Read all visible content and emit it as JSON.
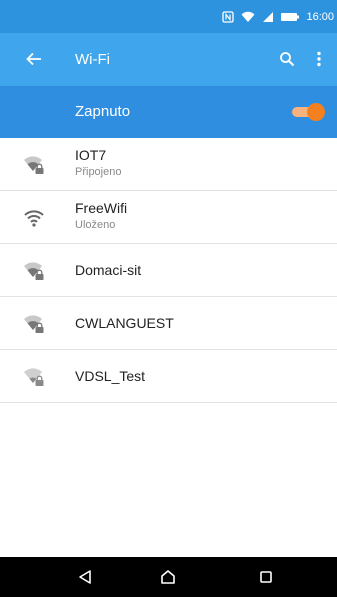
{
  "status": {
    "time": "16:00",
    "icons": [
      "nfc-icon",
      "wifi-signal-icon",
      "cell-signal-icon",
      "battery-icon"
    ]
  },
  "appbar": {
    "title": "Wi-Fi",
    "back_icon": "arrow-left-icon",
    "search_icon": "search-icon",
    "more_icon": "more-vert-icon"
  },
  "master": {
    "label": "Zapnuto",
    "on": true
  },
  "networks": [
    {
      "name": "IOT7",
      "status": "Připojeno",
      "secured": true
    },
    {
      "name": "FreeWifi",
      "status": "Uloženo",
      "secured": false
    },
    {
      "name": "Domaci-sit",
      "status": "",
      "secured": true
    },
    {
      "name": "CWLANGUEST",
      "status": "",
      "secured": true
    },
    {
      "name": "VDSL_Test",
      "status": "",
      "secured": true
    }
  ],
  "nav": {
    "icons": [
      "back-triangle-icon",
      "home-icon",
      "recents-icon"
    ]
  },
  "colors": {
    "status_bar": "#2e93de",
    "app_bar": "#3fa6ee",
    "master_bar": "#2f8ee0",
    "toggle_on": "#f5801f"
  }
}
